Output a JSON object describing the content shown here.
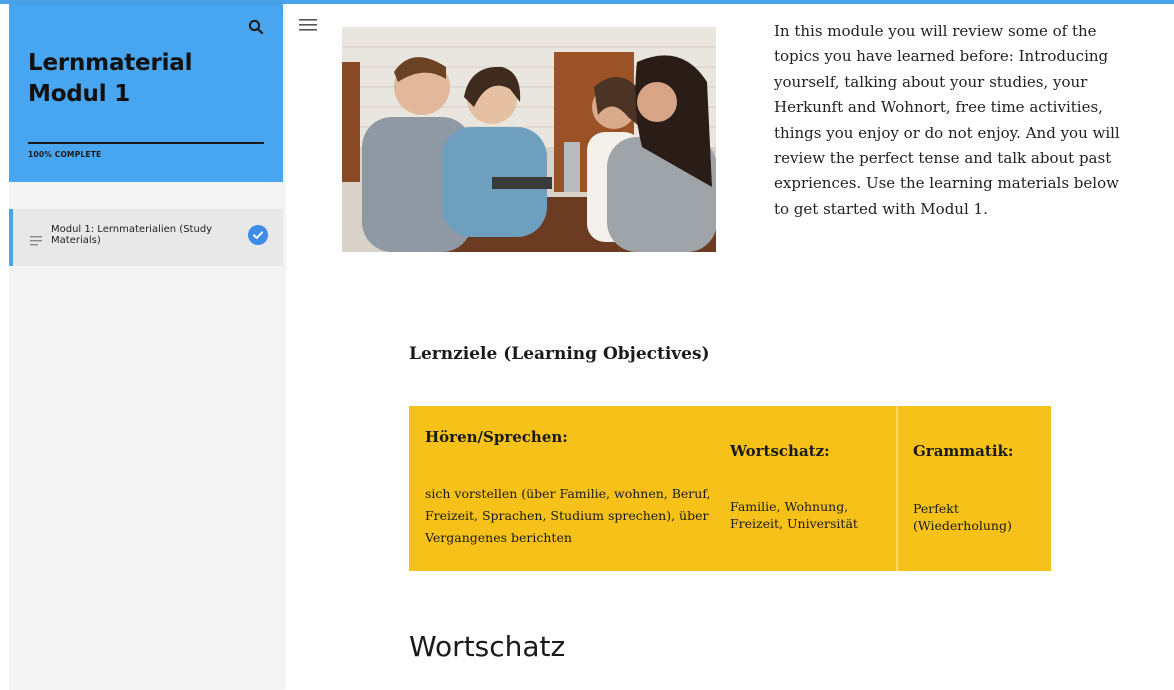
{
  "sidebar": {
    "title": "Lernmaterial Modul 1",
    "progress_text": "100% COMPLETE",
    "progress_value": 1.0,
    "items": [
      {
        "label": "Modul 1: Lernmaterialien (Study Materials)",
        "status_icon": "check-circle-icon",
        "completed": true
      }
    ],
    "icons": {
      "search": "search-icon",
      "lesson": "lines-icon"
    }
  },
  "main": {
    "menu_icon": "hamburger-menu-icon",
    "intro": "In this module you will review some of the topics you have learned before: Introducing yourself, talking about your studies, your Herkunft and Wohnort, free time activities, things you enjoy or do not enjoy. And you will review the perfect tense and talk about past expriences. Use the learning materials below to get started with Modul 1.",
    "objectives_heading": "Lernziele (Learning Objectives)",
    "objectives": [
      {
        "heading": "Hören/Sprechen:",
        "body": "sich vorstellen (über Familie, wohnen, Beruf, Freizeit, Sprachen, Studium sprechen), über Vergangenes berichten"
      },
      {
        "heading": "Wortschatz:",
        "body": "Familie, Wohnung, Freizeit, Universität"
      },
      {
        "heading": "Grammatik:",
        "body": "Perfekt (Wiederholung)"
      }
    ],
    "section_heading": "Wortschatz"
  },
  "colors": {
    "accent": "#48a5f0",
    "table_bg": "#f6c21a",
    "check": "#3d8de6"
  }
}
